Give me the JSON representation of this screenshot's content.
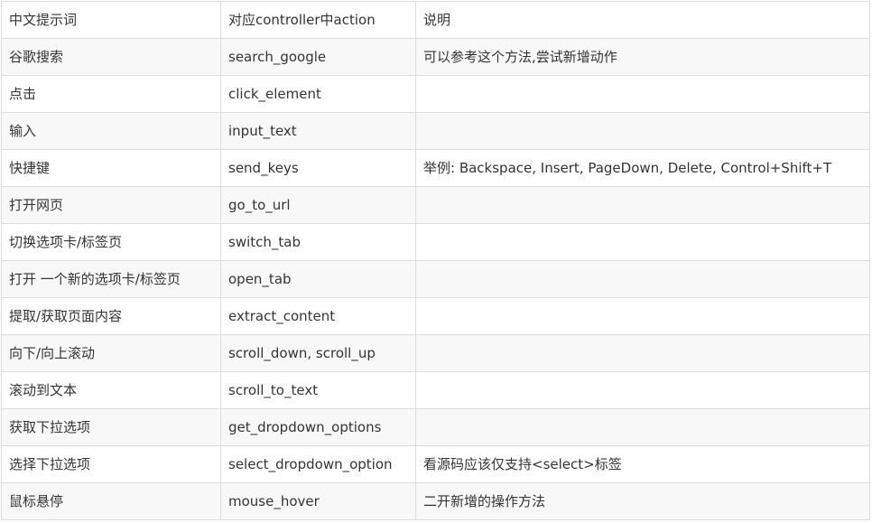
{
  "table": {
    "headers": [
      "中文提示词",
      "对应controller中action",
      "说明"
    ],
    "rows": [
      [
        "谷歌搜索",
        "search_google",
        "可以参考这个方法,尝试新增动作"
      ],
      [
        "点击",
        "click_element",
        ""
      ],
      [
        "输入",
        "input_text",
        ""
      ],
      [
        "快捷键",
        "send_keys",
        "举例: Backspace, Insert, PageDown, Delete, Control+Shift+T"
      ],
      [
        "打开网页",
        "go_to_url",
        ""
      ],
      [
        "切换选项卡/标签页",
        "switch_tab",
        ""
      ],
      [
        "打开 一个新的选项卡/标签页",
        "open_tab",
        ""
      ],
      [
        "提取/获取页面内容",
        "extract_content",
        ""
      ],
      [
        "向下/向上滚动",
        "scroll_down, scroll_up",
        ""
      ],
      [
        "滚动到文本",
        "scroll_to_text",
        ""
      ],
      [
        "获取下拉选项",
        "get_dropdown_options",
        ""
      ],
      [
        "选择下拉选项",
        "select_dropdown_option",
        "看源码应该仅支持<select>标签"
      ],
      [
        "鼠标悬停",
        "mouse_hover",
        "二开新增的操作方法"
      ]
    ]
  }
}
